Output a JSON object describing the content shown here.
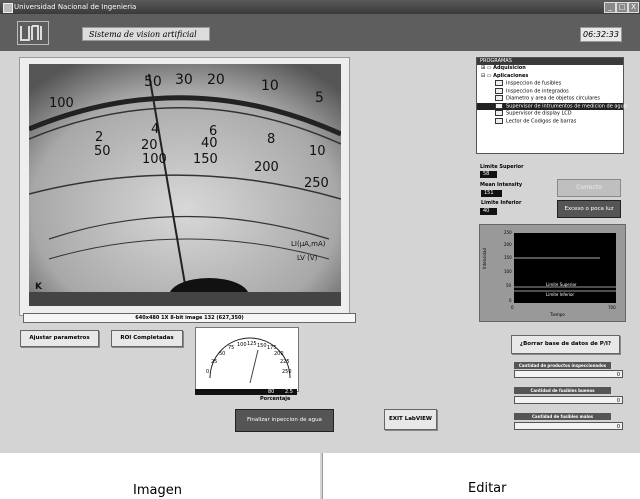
{
  "window": {
    "title": "Universidad Nacional de Ingenieria",
    "controls": [
      "_",
      "□",
      "X"
    ]
  },
  "header": {
    "app_name": "Sistema de vision artificial",
    "time": "06:32:33",
    "logo_text": "Uni"
  },
  "camera": {
    "info": "640x480 1X 8-bit image 132   (627,350)",
    "scale_labels_top": [
      "50",
      "30",
      "20",
      "10",
      "5"
    ],
    "scale_labels_mid": [
      "100",
      "50",
      "2",
      "4",
      "6",
      "8",
      "10"
    ],
    "scale_labels_low": [
      "20",
      "40",
      "100",
      "150",
      "200",
      "250"
    ],
    "units": [
      "LI(µA,mA)",
      "LV (V)",
      "K"
    ]
  },
  "programs": {
    "header": "PROGRAMAS",
    "groups": [
      "Adquisicion",
      "Aplicaciones"
    ],
    "items": [
      "Inspeccion de fusibles",
      "Inspeccion de integrados",
      "Diametro y area de objetos circulares",
      "Supervisor de intrumentos de medicion de agua",
      "Supervisor de display LCD",
      "Lector de Codigos de barras"
    ],
    "selected_index": 3
  },
  "limits": {
    "upper_label": "Limite Superior",
    "upper_value": "58",
    "mean_label": "Mean Intensity",
    "mean_value": "151",
    "lower_label": "Limite Inferior",
    "lower_value": "40"
  },
  "status": {
    "correct_label": "Correcto",
    "excess_label": "Exceso o poca luz"
  },
  "graph": {
    "ylabel": "Intensidad",
    "xlabel": "Tiempo",
    "yticks": [
      "250",
      "200",
      "150",
      "100",
      "50",
      "0"
    ],
    "xticks": [
      "0",
      "700"
    ],
    "upper_line_label": "Limite Superior",
    "lower_line_label": "Limite Inferior"
  },
  "buttons": {
    "adjust": "Ajustar parametros",
    "roi": "ROI Completadas",
    "finish": "Finalizar inpeccion de agua",
    "exit": "EXIT LabVIEW",
    "delete_db": "¿Borrar base de datos de P/I?"
  },
  "gauge": {
    "ticks": [
      "0",
      "25",
      "50",
      "75",
      "100",
      "125",
      "150",
      "175",
      "200",
      "225",
      "250"
    ],
    "value": "2.5",
    "pct": "80",
    "label": "Porcentaje"
  },
  "counters": [
    {
      "label": "Cantidad de productos inspeccionados",
      "value": "0"
    },
    {
      "label": "Cantidad de fusibles buenos",
      "value": "0"
    },
    {
      "label": "Cantidad de fusibles malos",
      "value": "0"
    }
  ],
  "tabs": {
    "left": "Imagen",
    "right": "Editar"
  }
}
